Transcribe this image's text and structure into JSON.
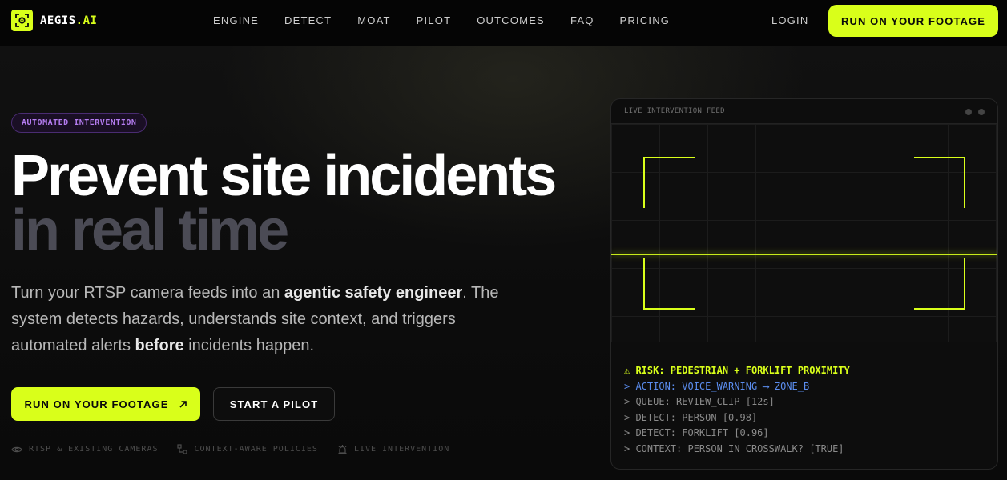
{
  "brand": {
    "name": "AEGIS",
    "suffix": ".AI",
    "accent": "#d9ff1a"
  },
  "nav": {
    "links": [
      "ENGINE",
      "DETECT",
      "MOAT",
      "PILOT",
      "OUTCOMES",
      "FAQ",
      "PRICING"
    ],
    "login": "LOGIN",
    "cta": "RUN ON YOUR FOOTAGE"
  },
  "hero": {
    "badge": "AUTOMATED INTERVENTION",
    "headline_line1": "Prevent site incidents",
    "headline_line2": "in real time",
    "desc_part1": "Turn your RTSP camera feeds into an ",
    "desc_bold1": "agentic safety engineer",
    "desc_part2": ". The system detects hazards, understands site context, and triggers automated alerts ",
    "desc_bold2": "before",
    "desc_part3": " incidents happen.",
    "primary_cta": "RUN ON YOUR FOOTAGE",
    "secondary_cta": "START A PILOT",
    "features": [
      {
        "icon": "eye-icon",
        "label": "RTSP & EXISTING CAMERAS"
      },
      {
        "icon": "nodes-icon",
        "label": "CONTEXT-AWARE POLICIES"
      },
      {
        "icon": "alarm-icon",
        "label": "LIVE INTERVENTION"
      }
    ]
  },
  "feed": {
    "title": "LIVE_INTERVENTION_FEED",
    "log": [
      {
        "type": "risk",
        "text": "⚠ RISK: PEDESTRIAN + FORKLIFT PROXIMITY"
      },
      {
        "type": "action",
        "text": "> ACTION: VOICE_WARNING ⟶ ZONE_B"
      },
      {
        "type": "muted",
        "text": "> QUEUE: REVIEW_CLIP [12s]"
      },
      {
        "type": "muted",
        "text": "> DETECT: PERSON [0.98]"
      },
      {
        "type": "muted",
        "text": "> DETECT: FORKLIFT [0.96]"
      },
      {
        "type": "muted",
        "text": "> CONTEXT: PERSON_IN_CROSSWALK? [TRUE]"
      }
    ]
  },
  "colors": {
    "accent": "#d9ff1a",
    "badge_purple": "#b47cf0",
    "action_blue": "#5b8def",
    "headline_dim": "#4b4b55"
  }
}
